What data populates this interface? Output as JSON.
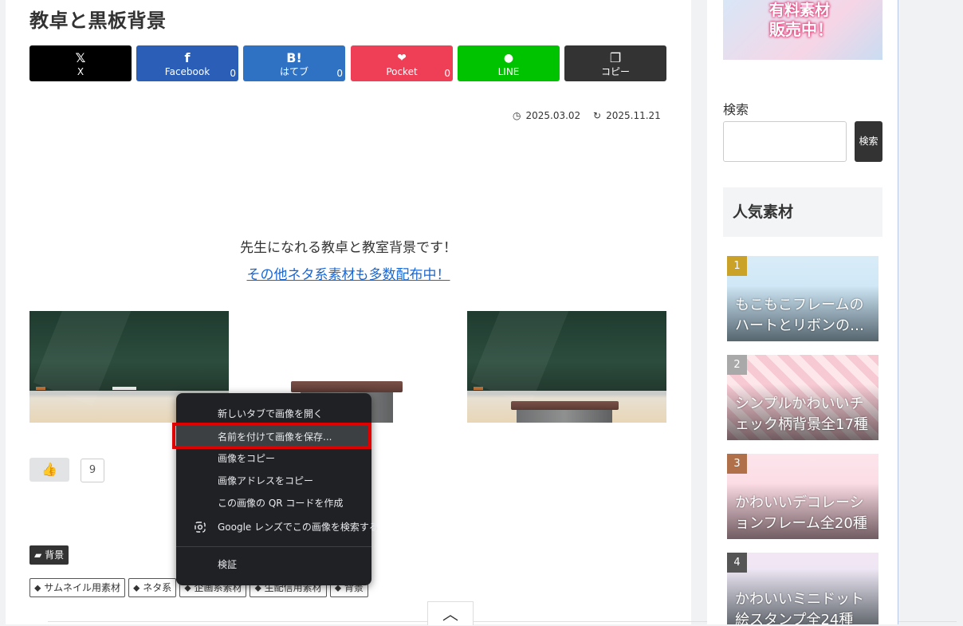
{
  "article": {
    "title": "教卓と黒板背景",
    "share": {
      "x": {
        "label": "X",
        "icon": "𝕏",
        "color": "#000000"
      },
      "facebook": {
        "label": "Facebook",
        "icon": "f",
        "count": "0",
        "color": "#2b5eb6"
      },
      "hatena": {
        "label": "はてブ",
        "icon": "B!",
        "count": "0",
        "color": "#2f72c4"
      },
      "pocket": {
        "label": "Pocket",
        "icon": "❤",
        "count": "0",
        "color": "#ef3f56"
      },
      "line": {
        "label": "LINE",
        "icon": "●",
        "color": "#00c300"
      },
      "copy": {
        "label": "コピー",
        "icon": "❐",
        "color": "#333333"
      }
    },
    "published": "2025.03.02",
    "updated": "2025.11.21",
    "intro_text": "先生になれる教卓と教室背景です！",
    "intro_link": "その他ネタ系素材も多数配布中！",
    "like_count": "9",
    "category": "背景",
    "tags": [
      "サムネイル用素材",
      "ネタ系",
      "企画系素材",
      "生配信用素材",
      "背景"
    ]
  },
  "sidebar": {
    "banner_line1": "有料素材",
    "banner_line2": "販売中！",
    "search_label": "検索",
    "search_value": "",
    "search_button": "検索",
    "popular_title": "人気素材",
    "ranking": [
      {
        "rank": "1",
        "title": "もこもこフレームのハートとリボンの…",
        "badge_color": "#c9a227"
      },
      {
        "rank": "2",
        "title": "シンプルかわいいチェック柄背景全17種",
        "badge_color": "#a9a9a9"
      },
      {
        "rank": "3",
        "title": "かわいいデコレーションフレーム全20種",
        "badge_color": "#b0704a"
      },
      {
        "rank": "4",
        "title": "かわいいミニドット絵スタンプ全24種",
        "badge_color": "#555555"
      }
    ]
  },
  "context_menu": {
    "items": [
      "新しいタブで画像を開く",
      "名前を付けて画像を保存...",
      "画像をコピー",
      "画像アドレスをコピー",
      "この画像の QR コードを作成",
      "Google レンズでこの画像を検索する",
      "検証"
    ],
    "highlighted_index": 1
  },
  "scroll_top_icon": "chevron-up"
}
